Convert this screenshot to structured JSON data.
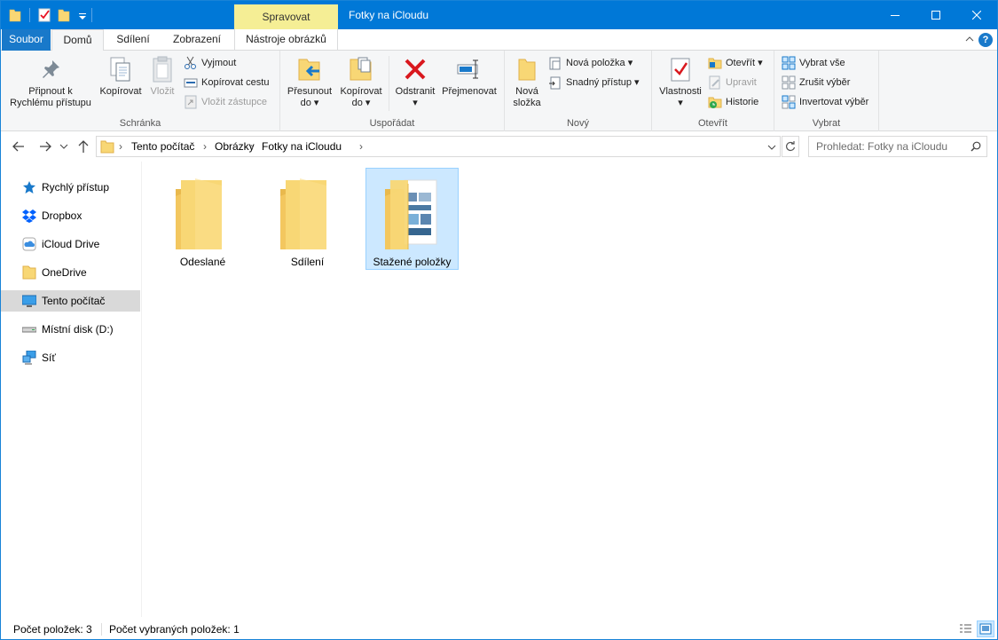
{
  "window": {
    "title": "Fotky na iCloudu",
    "contextual_tab_header": "Spravovat"
  },
  "tabs": {
    "file": "Soubor",
    "home": "Domů",
    "share": "Sdílení",
    "view": "Zobrazení",
    "picture_tools": "Nástroje obrázků"
  },
  "ribbon": {
    "clipboard": {
      "label": "Schránka",
      "pin_line1": "Připnout k",
      "pin_line2": "Rychlému přístupu",
      "copy": "Kopírovat",
      "paste": "Vložit",
      "cut": "Vyjmout",
      "copy_path": "Kopírovat cestu",
      "paste_shortcut": "Vložit zástupce"
    },
    "organize": {
      "label": "Uspořádat",
      "move_line1": "Přesunout",
      "move_line2": "do",
      "copy_line1": "Kopírovat",
      "copy_line2": "do",
      "delete": "Odstranit",
      "rename": "Přejmenovat"
    },
    "new": {
      "label": "Nový",
      "new_folder_line1": "Nová",
      "new_folder_line2": "složka",
      "new_item": "Nová položka",
      "easy_access": "Snadný přístup"
    },
    "open": {
      "label": "Otevřít",
      "properties": "Vlastnosti",
      "open": "Otevřít",
      "edit": "Upravit",
      "history": "Historie"
    },
    "select": {
      "label": "Vybrat",
      "select_all": "Vybrat vše",
      "select_none": "Zrušit výběr",
      "invert": "Invertovat výběr"
    }
  },
  "address": {
    "crumbs": [
      "Tento počítač",
      "Obrázky",
      "Fotky na iCloudu"
    ],
    "search_placeholder": "Prohledat: Fotky na iCloudu"
  },
  "sidebar": {
    "items": [
      {
        "label": "Rychlý přístup",
        "icon": "star-icon"
      },
      {
        "label": "Dropbox",
        "icon": "dropbox-icon"
      },
      {
        "label": "iCloud Drive",
        "icon": "icloud-icon"
      },
      {
        "label": "OneDrive",
        "icon": "folder-icon"
      },
      {
        "label": "Tento počítač",
        "icon": "computer-icon"
      },
      {
        "label": "Místní disk (D:)",
        "icon": "drive-icon"
      },
      {
        "label": "Síť",
        "icon": "network-icon"
      }
    ]
  },
  "folders": [
    {
      "name": "Odeslané"
    },
    {
      "name": "Sdílení"
    },
    {
      "name": "Stažené položky"
    }
  ],
  "status": {
    "count": "Počet položek: 3",
    "selected": "Počet vybraných položek: 1"
  },
  "colors": {
    "titlebar": "#0078d7",
    "context_tab": "#f5ee95",
    "selection": "#cce8ff",
    "folder": "#f8d775"
  }
}
